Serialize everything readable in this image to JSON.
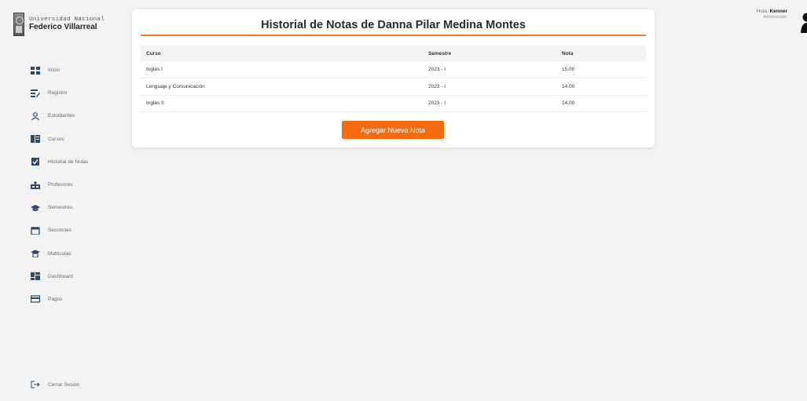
{
  "brand": {
    "line1": "Universidad Nacional",
    "line2": "Federico Villarreal"
  },
  "sidebar": {
    "items": [
      {
        "label": "Inicio",
        "icon": "grid-icon"
      },
      {
        "label": "Registro",
        "icon": "register-icon"
      },
      {
        "label": "Estudiantes",
        "icon": "user-icon"
      },
      {
        "label": "Cursos",
        "icon": "book-icon"
      },
      {
        "label": "Historial de Notas",
        "icon": "checkbox-icon"
      },
      {
        "label": "Profesores",
        "icon": "teacher-icon"
      },
      {
        "label": "Semestres",
        "icon": "graduation-cap-icon"
      },
      {
        "label": "Secciones",
        "icon": "calendar-icon"
      },
      {
        "label": "Matriculas",
        "icon": "enroll-icon"
      },
      {
        "label": "Dashboard",
        "icon": "dashboard-icon"
      },
      {
        "label": "Pagos",
        "icon": "card-icon"
      }
    ],
    "logout": "Cerrar Sesión"
  },
  "user": {
    "greeting": "Hola,",
    "name": "Kenner",
    "role": "Administrador"
  },
  "main": {
    "title": "Historial de Notas de Danna Pilar Medina Montes",
    "table": {
      "headers": [
        "Curso",
        "Semestre",
        "Nota"
      ],
      "rows": [
        [
          "Inglés I",
          "2023 - I",
          "15.00"
        ],
        [
          "Lenguaje y Comunicación",
          "2023 - I",
          "14.00"
        ],
        [
          "Inglés II",
          "2023 - I",
          "14.00"
        ]
      ]
    },
    "add_button": "Agregar Nueva Nota"
  },
  "colors": {
    "accent": "#f56a0c",
    "rule": "#f07a2a",
    "icon": "#2b4a6b"
  }
}
